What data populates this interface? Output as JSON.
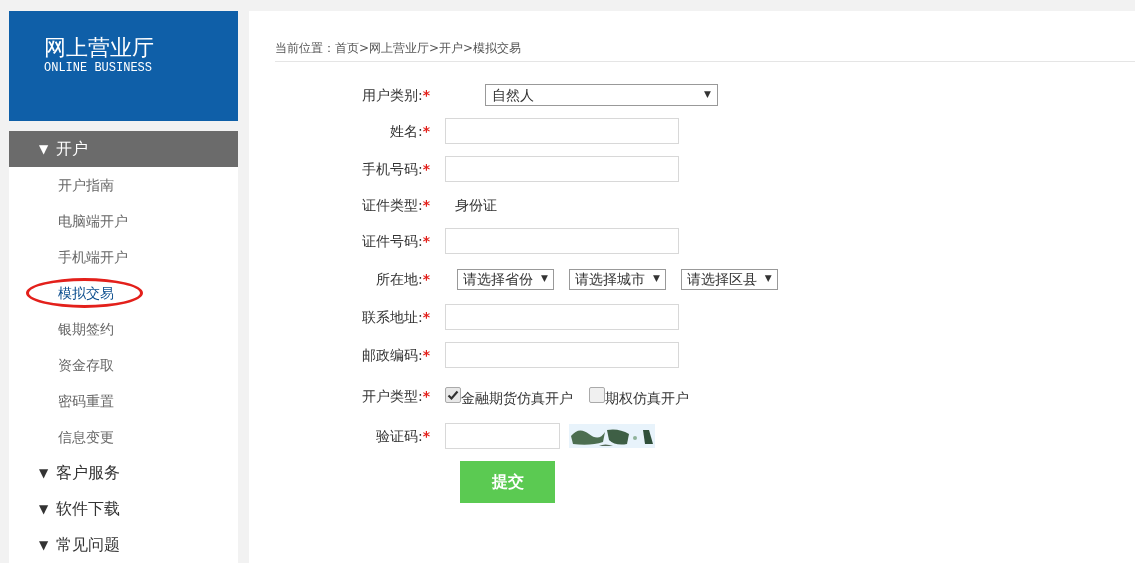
{
  "logo": {
    "title": "网上营业厅",
    "subtitle": "ONLINE BUSINESS"
  },
  "sidebar": {
    "sections": [
      {
        "label": "开户",
        "expanded": true,
        "icon": "▼",
        "items": [
          {
            "label": "开户指南",
            "selected": false,
            "circled": false
          },
          {
            "label": "电脑端开户",
            "selected": false,
            "circled": false
          },
          {
            "label": "手机端开户",
            "selected": false,
            "circled": false
          },
          {
            "label": "模拟交易",
            "selected": true,
            "circled": true
          },
          {
            "label": "银期签约",
            "selected": false,
            "circled": false
          },
          {
            "label": "资金存取",
            "selected": false,
            "circled": false
          },
          {
            "label": "密码重置",
            "selected": false,
            "circled": false
          },
          {
            "label": "信息变更",
            "selected": false,
            "circled": false
          }
        ]
      },
      {
        "label": "客户服务",
        "expanded": false,
        "icon": "▼"
      },
      {
        "label": "软件下载",
        "expanded": false,
        "icon": "▼"
      },
      {
        "label": "常见问题",
        "expanded": false,
        "icon": "▼"
      }
    ]
  },
  "breadcrumb": "当前位置：首页>网上营业厅>开户>模拟交易",
  "form": {
    "rows": [
      {
        "kind": "select",
        "label": "用户类别:",
        "required_mark": "*",
        "value": "自然人"
      },
      {
        "kind": "input",
        "label": "姓名:",
        "required_mark": "*"
      },
      {
        "kind": "input",
        "label": "手机号码:",
        "required_mark": "*"
      },
      {
        "kind": "text",
        "label": "证件类型:",
        "required_mark": "*",
        "value": "身份证"
      },
      {
        "kind": "input",
        "label": "证件号码:",
        "required_mark": "*"
      },
      {
        "kind": "selects",
        "label": "所在地:",
        "required_mark": "*",
        "options": [
          "请选择省份",
          "请选择城市",
          "请选择区县"
        ]
      },
      {
        "kind": "input",
        "label": "联系地址:",
        "required_mark": "*"
      },
      {
        "kind": "input",
        "label": "邮政编码:",
        "required_mark": "*"
      },
      {
        "kind": "checkboxes",
        "label": "开户类型:",
        "required_mark": "*",
        "options": [
          {
            "label": "金融期货仿真开户",
            "checked": true
          },
          {
            "label": "期权仿真开户",
            "checked": false
          }
        ]
      },
      {
        "kind": "captcha",
        "label": "验证码:",
        "required_mark": "*"
      }
    ],
    "submit": "提交"
  }
}
